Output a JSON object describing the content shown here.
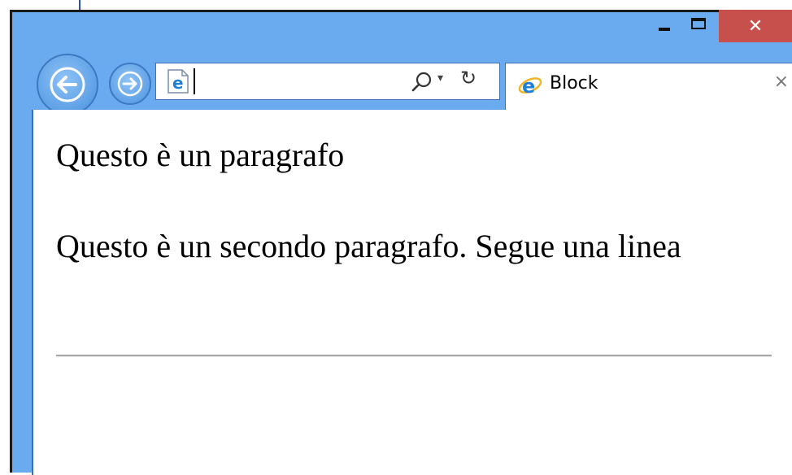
{
  "window": {
    "tab_title": "Block",
    "address_value": "",
    "tab_close_glyph": "×",
    "close_glyph": "✕",
    "refresh_glyph": "↻",
    "dropdown_glyph": "▾"
  },
  "icons": {
    "back": "arrow-left-icon",
    "forward": "arrow-right-icon",
    "search": "search-icon",
    "refresh": "refresh-icon",
    "ie": "internet-explorer-icon"
  },
  "content": {
    "paragraph_1": "Questo è un paragrafo",
    "paragraph_2": "Questo è un secondo paragrafo. Segue una linea"
  },
  "colors": {
    "chrome": "#6aabf0",
    "close_button": "#c7504c",
    "border": "#3f6fb5"
  }
}
